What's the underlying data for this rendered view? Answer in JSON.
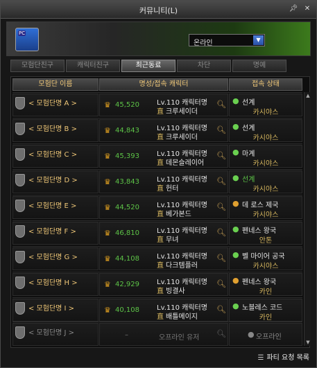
{
  "window": {
    "title": "커뮤니티(L)",
    "pin_icon": "pin-icon",
    "close_icon": "close-icon"
  },
  "header": {
    "avatar_badge": "PC",
    "status": "온라인"
  },
  "tabs": [
    {
      "label": "모험단친구",
      "active": false
    },
    {
      "label": "캐릭터친구",
      "active": false
    },
    {
      "label": "최근동료",
      "active": true
    },
    {
      "label": "차단",
      "active": false
    },
    {
      "label": "명예",
      "active": false
    }
  ],
  "columns": {
    "group": "모험단 이름",
    "fame_char": "명성/접속 캐릭터",
    "status": "접속 상태"
  },
  "rows": [
    {
      "group": "< 모험단명 A >",
      "fame": "45,520",
      "line1": "Lv.110 캐릭터명",
      "job": "直",
      "line2": "크루세이더",
      "pin": "green",
      "chan": "선계",
      "chan_color": "white",
      "world": "카시야스"
    },
    {
      "group": "< 모험단명 B >",
      "fame": "44,843",
      "line1": "Lv.110 캐릭터명",
      "job": "直",
      "line2": "크루세이더",
      "pin": "green",
      "chan": "선계",
      "chan_color": "white",
      "world": "카시야스"
    },
    {
      "group": "< 모험단명 C >",
      "fame": "45,393",
      "line1": "Lv.110 캐릭터명",
      "job": "直",
      "line2": "데몬슬레이어",
      "pin": "green",
      "chan": "마계",
      "chan_color": "white",
      "world": "카시야스"
    },
    {
      "group": "< 모험단명 D >",
      "fame": "43,843",
      "line1": "Lv.110 캐릭터명",
      "job": "直",
      "line2": "헌터",
      "pin": "green",
      "chan": "선계",
      "chan_color": "green",
      "world": "카시야스"
    },
    {
      "group": "< 모험단명 E >",
      "fame": "44,520",
      "line1": "Lv.110 캐릭터명",
      "job": "直",
      "line2": "베가본드",
      "pin": "orange",
      "chan": "데 로스 제국",
      "chan_color": "white",
      "world": "카시야스"
    },
    {
      "group": "< 모험단명 F >",
      "fame": "46,810",
      "line1": "Lv.110 캐릭터명",
      "job": "直",
      "line2": "무녀",
      "pin": "green",
      "chan": "펜네스 왕국",
      "chan_color": "white",
      "world": "안톤"
    },
    {
      "group": "< 모험단명 G >",
      "fame": "44,108",
      "line1": "Lv.110 캐릭터명",
      "job": "直",
      "line2": "다크템플러",
      "pin": "green",
      "chan": "벨 마이어 공국",
      "chan_color": "white",
      "world": "카시야스"
    },
    {
      "group": "< 모험단명 H >",
      "fame": "42,929",
      "line1": "Lv.110 캐릭터명",
      "job": "直",
      "line2": "빙결사",
      "pin": "orange",
      "chan": "펜네스 왕국",
      "chan_color": "white",
      "world": "카인"
    },
    {
      "group": "< 모험단명 I >",
      "fame": "40,108",
      "line1": "Lv.110 캐릭터명",
      "job": "直",
      "line2": "배틀메이지",
      "pin": "green",
      "chan": "노블레스 코드",
      "chan_color": "white",
      "world": "카인"
    }
  ],
  "offline_row": {
    "group": "< 모험단명 J >",
    "dash": "–",
    "user": "오프라인 유저",
    "status": "오프라인"
  },
  "footer": {
    "party_button": "파티 요청 목록"
  }
}
